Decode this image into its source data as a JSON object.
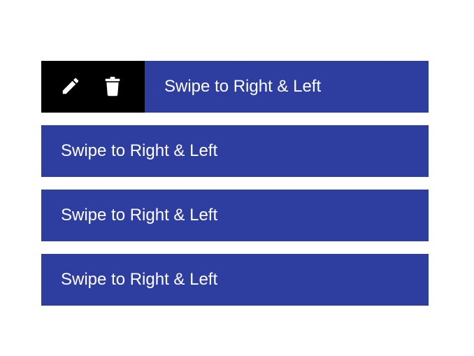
{
  "theme": {
    "item_background": "#2e3ea0",
    "action_background": "#000000",
    "text_color": "#ffffff"
  },
  "list": {
    "items": [
      {
        "label": "Swipe to Right & Left",
        "swiped_open": true
      },
      {
        "label": "Swipe to Right & Left",
        "swiped_open": false
      },
      {
        "label": "Swipe to Right & Left",
        "swiped_open": false
      },
      {
        "label": "Swipe to Right & Left",
        "swiped_open": false
      }
    ],
    "actions": {
      "edit_icon": "pencil-icon",
      "delete_icon": "trash-icon"
    }
  }
}
